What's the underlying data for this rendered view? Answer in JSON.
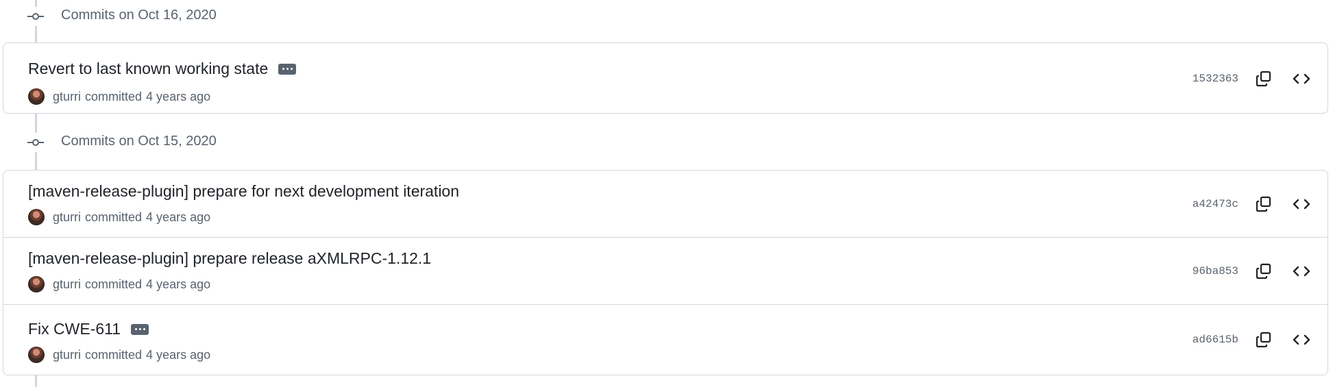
{
  "groups": [
    {
      "header": "Commits on Oct 16, 2020",
      "commits": [
        {
          "title": "Revert to last known working state",
          "has_ellipsis": true,
          "author": "gturri",
          "action": "committed",
          "time": "4 years ago",
          "sha": "1532363"
        }
      ]
    },
    {
      "header": "Commits on Oct 15, 2020",
      "commits": [
        {
          "title": "[maven-release-plugin] prepare for next development iteration",
          "has_ellipsis": false,
          "author": "gturri",
          "action": "committed",
          "time": "4 years ago",
          "sha": "a42473c"
        },
        {
          "title": "[maven-release-plugin] prepare release aXMLRPC-1.12.1",
          "has_ellipsis": false,
          "author": "gturri",
          "action": "committed",
          "time": "4 years ago",
          "sha": "96ba853"
        },
        {
          "title": "Fix CWE-611",
          "has_ellipsis": true,
          "author": "gturri",
          "action": "committed",
          "time": "4 years ago",
          "sha": "ad6615b"
        }
      ]
    }
  ],
  "icons": {
    "commit_node": "git-commit-icon",
    "copy": "copy-icon",
    "browse": "code-icon",
    "ellipsis": "ellipsis-icon"
  },
  "colors": {
    "muted": "#59636e",
    "border": "#d0d7de",
    "text": "#1f2328"
  }
}
